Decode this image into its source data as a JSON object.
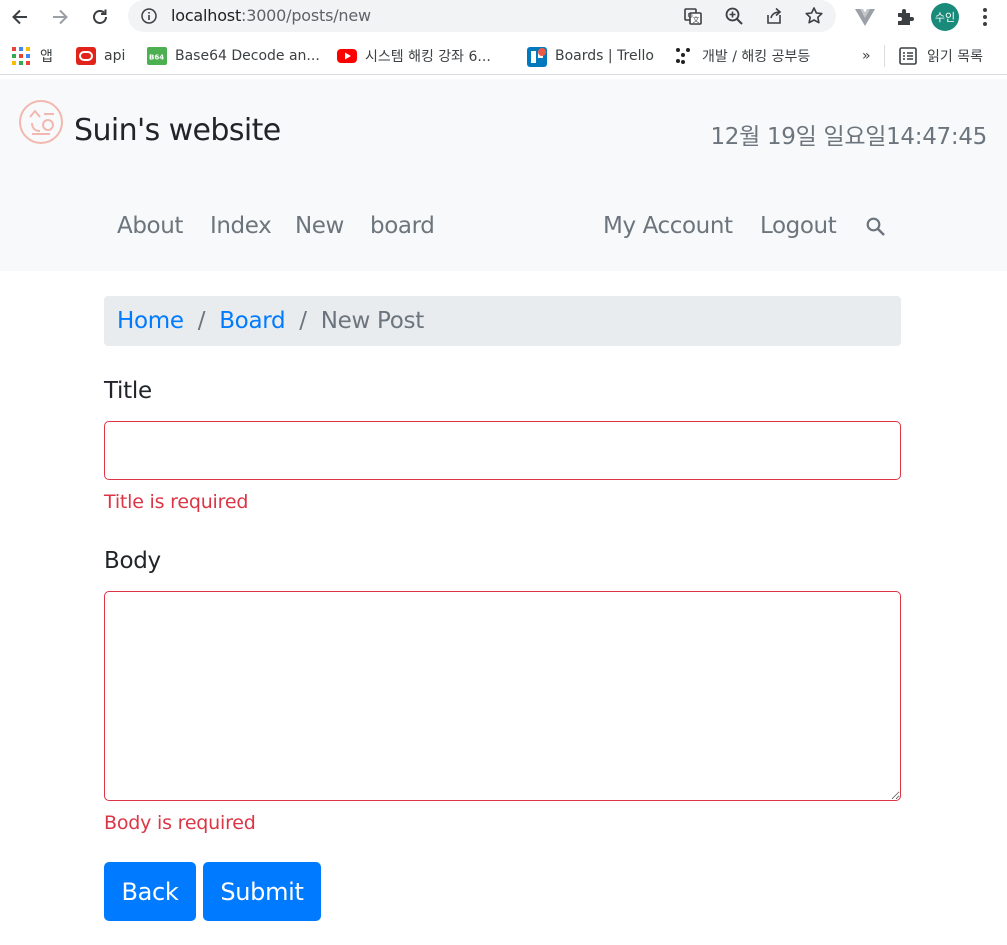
{
  "browser": {
    "url_host": "localhost",
    "url_path": ":3000/posts/new",
    "profile_initials": "수인",
    "bookmarks": [
      {
        "label": "앱",
        "icon": "apps-grid-icon"
      },
      {
        "label": "api",
        "icon": "oracle-icon"
      },
      {
        "label": "Base64 Decode an...",
        "icon": "b64-icon"
      },
      {
        "label": "시스템 해킹 강좌 6...",
        "icon": "youtube-icon"
      },
      {
        "label": "Boards | Trello",
        "icon": "trello-icon"
      },
      {
        "label": "개발 / 해킹 공부등",
        "icon": "dots-icon"
      }
    ],
    "overflow": "»",
    "reading_list": "읽기 목록"
  },
  "header": {
    "brand": "Suin's website",
    "clock": "12월 19일 일요일14:47:45",
    "nav_left": [
      "About",
      "Index",
      "New",
      "board"
    ],
    "nav_right": [
      "My Account",
      "Logout"
    ]
  },
  "breadcrumb": {
    "home": "Home",
    "board": "Board",
    "separator": "/",
    "current": "New Post"
  },
  "form": {
    "title_label": "Title",
    "title_value": "",
    "title_error": "Title is required",
    "body_label": "Body",
    "body_value": "",
    "body_error": "Body is required",
    "back_label": "Back",
    "submit_label": "Submit"
  },
  "colors": {
    "primary": "#007bff",
    "danger": "#dc3545",
    "muted": "#6c757d",
    "header_bg": "#f8f9fa",
    "breadcrumb_bg": "#e9ecef"
  }
}
